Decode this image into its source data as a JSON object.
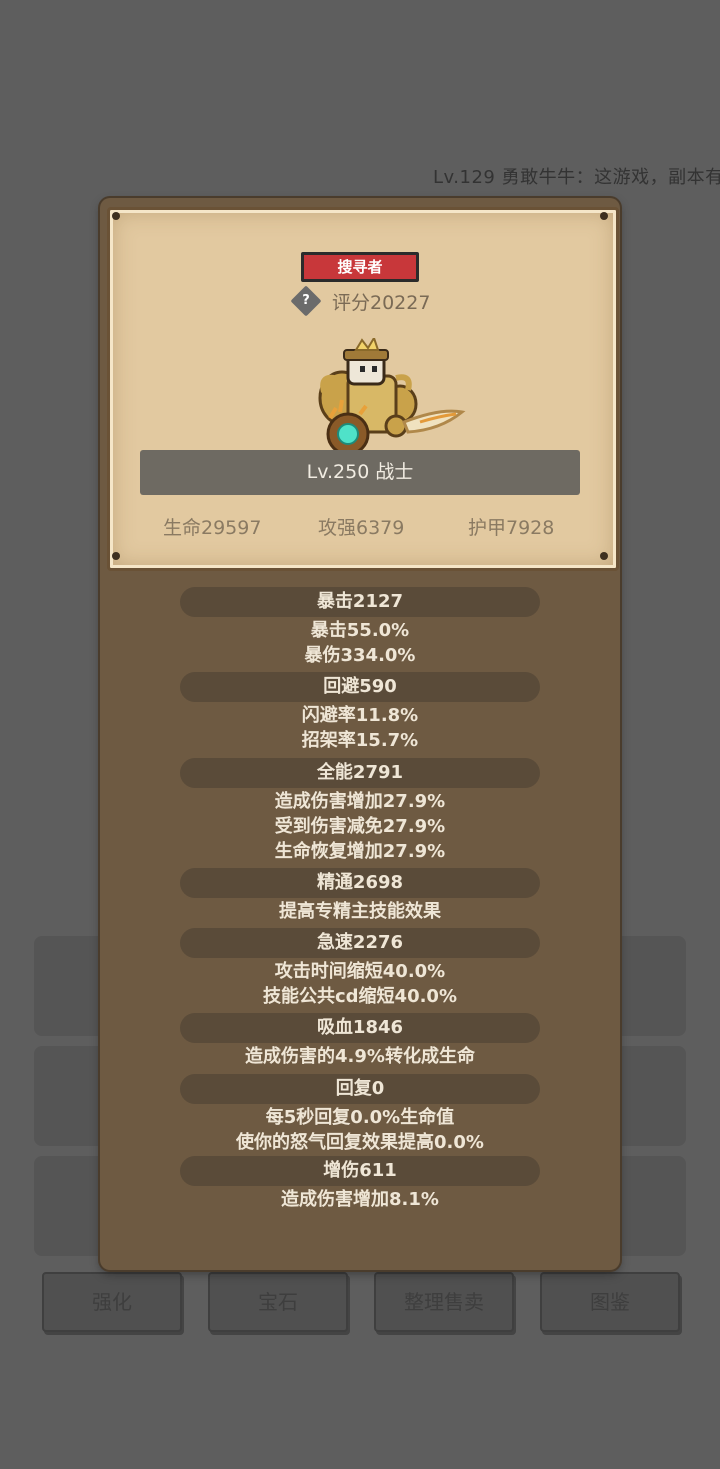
{
  "background": {
    "ticker": "Lv.129 勇敢牛牛：这游戏，副本有",
    "buttons": [
      "强化",
      "宝石",
      "整理售卖",
      "图鉴"
    ]
  },
  "card": {
    "class_tag": "搜寻者",
    "help_symbol": "?",
    "score": "评分20227",
    "level_class": "Lv.250 战士",
    "hp": "生命29597",
    "attack": "攻强6379",
    "armor": "护甲7928"
  },
  "stats": [
    {
      "head": "暴击2127",
      "lines": [
        "暴击55.0%",
        "暴伤334.0%"
      ]
    },
    {
      "head": "回避590",
      "lines": [
        "闪避率11.8%",
        "招架率15.7%"
      ]
    },
    {
      "head": "全能2791",
      "lines": [
        "造成伤害增加27.9%",
        "受到伤害减免27.9%",
        "生命恢复增加27.9%"
      ]
    },
    {
      "head": "精通2698",
      "lines": [
        "提高专精主技能效果"
      ]
    },
    {
      "head": "急速2276",
      "lines": [
        "攻击时间缩短40.0%",
        "技能公共cd缩短40.0%"
      ]
    },
    {
      "head": "吸血1846",
      "lines": [
        "造成伤害的4.9%转化成生命"
      ]
    },
    {
      "head": "回复0",
      "lines": [
        "每5秒回复0.0%生命值",
        "使你的怒气回复效果提高0.0%"
      ]
    },
    {
      "head": "增伤611",
      "lines": [
        "造成伤害增加8.1%"
      ]
    }
  ],
  "icons": {
    "help": "help-icon",
    "hero": "warrior-character-icon"
  },
  "colors": {
    "class_tag_bg": "#c8373a",
    "card_bg": "#e2c9a0",
    "panel_bg": "#6e5a42"
  }
}
